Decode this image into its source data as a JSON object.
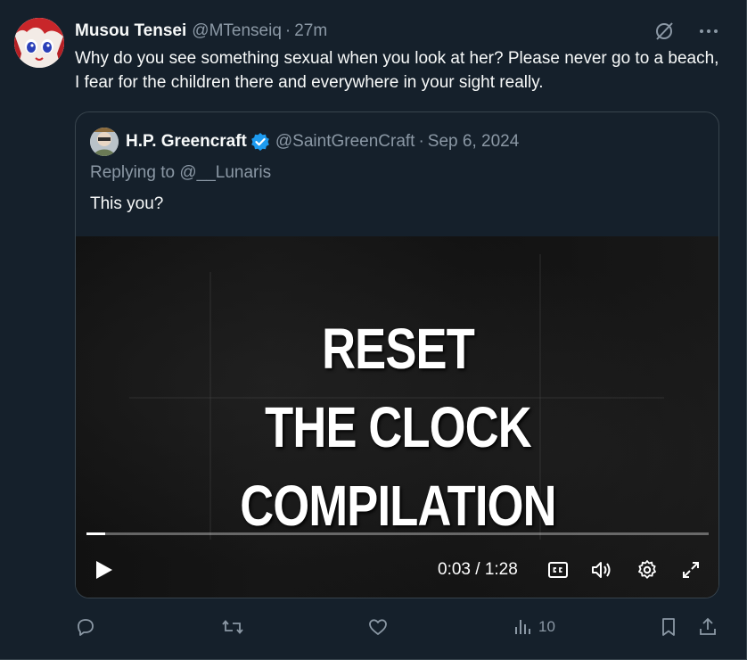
{
  "tweet": {
    "author_name": "Musou Tensei",
    "author_handle": "@MTenseiq",
    "separator": "·",
    "time_ago": "27m",
    "text": "Why do you see something sexual when you look at her? Please never go to a beach, I fear for the children there and everywhere in your sight really."
  },
  "quoted": {
    "author_name": "H.P. Greencraft",
    "author_handle": "@SaintGreenCraft",
    "separator": "·",
    "date": "Sep 6, 2024",
    "reply_to": "Replying to @__Lunaris",
    "text": "This you?",
    "video": {
      "title_lines": [
        "RESET",
        "THE CLOCK",
        "COMPILATION"
      ],
      "time_readout": "0:03 / 1:28",
      "progress": 0.03
    }
  },
  "actions": {
    "views_count": "10"
  },
  "icons": {
    "grok": "grok-icon",
    "more": "more-icon",
    "verified": "verified-badge-icon",
    "reply": "reply-icon",
    "retweet": "retweet-icon",
    "like": "like-icon",
    "views": "views-icon",
    "bookmark": "bookmark-icon",
    "share": "share-icon"
  },
  "colors": {
    "background": "#15202b",
    "text_primary": "#f7f9f9",
    "text_secondary": "#8b98a5",
    "border": "#38444d",
    "verified_blue": "#1d9bf0"
  }
}
